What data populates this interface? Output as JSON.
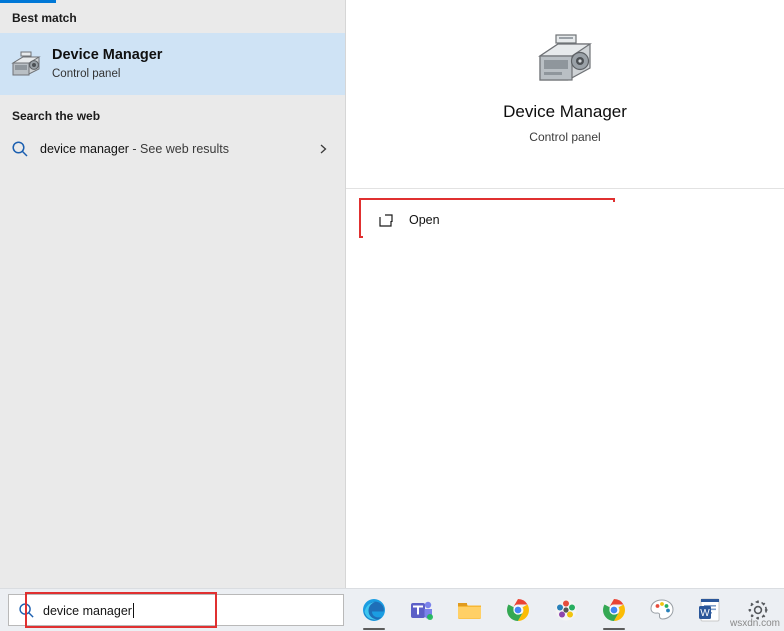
{
  "left_panel": {
    "best_match_header": "Best match",
    "best_match": {
      "title": "Device Manager",
      "subtitle": "Control panel",
      "icon": "device-manager-icon"
    },
    "web_header": "Search the web",
    "web_result": {
      "query": "device manager",
      "suffix": " - See web results",
      "icon": "search-icon",
      "chevron": "chevron-right-icon"
    }
  },
  "right_panel": {
    "preview": {
      "title": "Device Manager",
      "subtitle": "Control panel",
      "icon": "device-manager-icon"
    },
    "actions": [
      {
        "label": "Open",
        "icon": "open-external-icon",
        "highlight_color": "#e03030"
      }
    ]
  },
  "taskbar": {
    "search": {
      "value": "device manager",
      "placeholder": "Type here to search",
      "icon": "search-icon",
      "highlight_color": "#e03030"
    },
    "icons": [
      {
        "name": "microsoft-edge-icon",
        "active": true
      },
      {
        "name": "microsoft-teams-icon",
        "active": false
      },
      {
        "name": "file-explorer-icon",
        "active": false
      },
      {
        "name": "google-chrome-icon",
        "active": false
      },
      {
        "name": "app-colored-icon",
        "active": false
      },
      {
        "name": "google-chrome-canary-icon",
        "active": true
      },
      {
        "name": "paint-icon",
        "active": false
      },
      {
        "name": "microsoft-word-icon",
        "active": false
      },
      {
        "name": "settings-gear-icon",
        "active": false
      }
    ]
  },
  "watermark": "wsxdn.com",
  "colors": {
    "accent": "#0078d7",
    "selection": "#cfe3f5",
    "panel_bg": "#eaeaea",
    "highlight": "#e03030"
  }
}
